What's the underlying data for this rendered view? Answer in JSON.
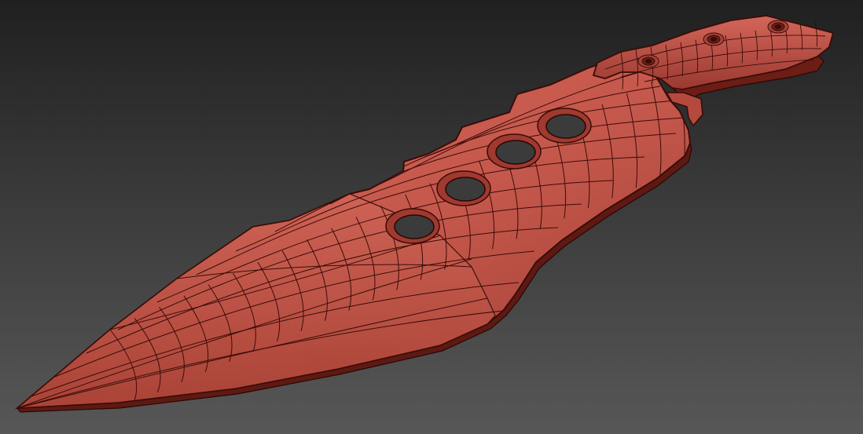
{
  "scene": {
    "subject": "",
    "colors": {
      "background_top": "#202020",
      "background_bottom": "#575757",
      "mesh_fill": "#c4574b",
      "mesh_fill_light": "#d9695b",
      "mesh_fill_dark": "#8c2f27",
      "wire": "#3a0c08"
    },
    "hole_count": 4,
    "handle_screw_count": 3
  }
}
